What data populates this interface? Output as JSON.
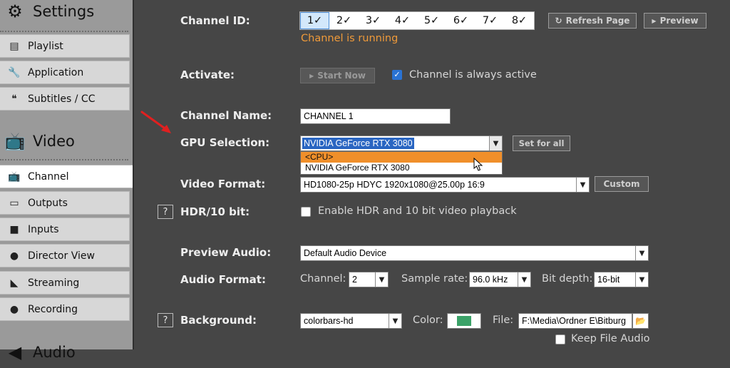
{
  "sidebar": {
    "settings_header": "Settings",
    "items_top": [
      {
        "label": "Playlist",
        "icon": "playlist-icon"
      },
      {
        "label": "Application",
        "icon": "wrench-icon"
      },
      {
        "label": "Subtitles / CC",
        "icon": "speech-icon"
      }
    ],
    "video_header": "Video",
    "items_video": [
      {
        "label": "Channel",
        "icon": "tv-icon"
      },
      {
        "label": "Outputs",
        "icon": "monitor-icon"
      },
      {
        "label": "Inputs",
        "icon": "camera-icon"
      },
      {
        "label": "Director View",
        "icon": "person-icon"
      },
      {
        "label": "Streaming",
        "icon": "rss-icon"
      },
      {
        "label": "Recording",
        "icon": "record-icon"
      }
    ],
    "audio_header": "Audio",
    "active_item": "Channel"
  },
  "channel_id": {
    "label": "Channel ID:",
    "tabs": [
      "1✓",
      "2✓",
      "3✓",
      "4✓",
      "5✓",
      "6✓",
      "7✓",
      "8✓"
    ],
    "selected": "1✓",
    "status": "Channel is running",
    "status_color": "#ef9a3a",
    "refresh_label": "Refresh Page",
    "preview_label": "Preview"
  },
  "activate": {
    "label": "Activate:",
    "start_label": "Start  Now",
    "always_active_label": "Channel is always active",
    "always_active_checked": true
  },
  "channel_name": {
    "label": "Channel Name:",
    "value": "CHANNEL 1"
  },
  "gpu": {
    "label": "GPU Selection:",
    "value": "NVIDIA GeForce RTX 3080",
    "options": [
      "<CPU>",
      "NVIDIA GeForce RTX 3080"
    ],
    "highlighted": "<CPU>",
    "set_all_label": "Set for all"
  },
  "video_format": {
    "label": "Video Format:",
    "value": "HD1080-25p HDYC 1920x1080@25.00p 16:9",
    "custom_label": "Custom"
  },
  "hdr": {
    "help": "?",
    "label": "HDR/10 bit:",
    "checkbox_label": "Enable HDR and 10 bit video playback",
    "checked": false
  },
  "preview_audio": {
    "label": "Preview Audio:",
    "value": "Default Audio Device"
  },
  "audio_format": {
    "label": "Audio Format:",
    "channel_label": "Channel:",
    "channel_value": "2",
    "sample_rate_label": "Sample rate:",
    "sample_rate_value": "96.0 kHz",
    "bit_depth_label": "Bit depth:",
    "bit_depth_value": "16-bit"
  },
  "background": {
    "help": "?",
    "label": "Background:",
    "value": "colorbars-hd",
    "color_label": "Color:",
    "color_value": "#3ba268",
    "file_label": "File:",
    "file_value": "F:\\Media\\Ordner E\\Bitburg",
    "keep_audio_label": "Keep File Audio",
    "keep_audio_checked": false
  },
  "colors": {
    "accent_orange": "#ef9a3a",
    "selection_blue": "#2a66c2",
    "dropdown_highlight": "#f08f2a"
  }
}
